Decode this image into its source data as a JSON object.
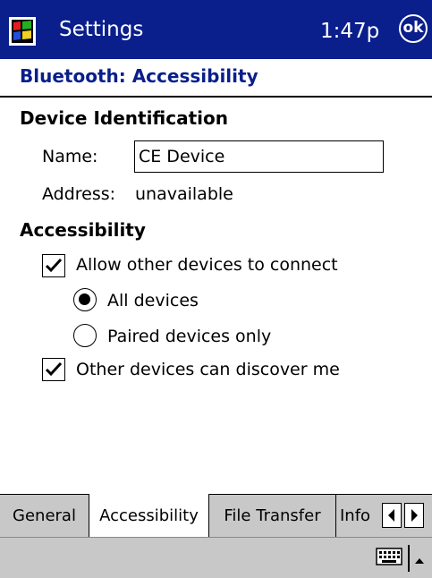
{
  "titlebar": {
    "app_title": "Settings",
    "clock": "1:47p",
    "ok_label": "ok",
    "start_icon": "windows-flag-icon",
    "color": "#0a1f8c"
  },
  "page": {
    "header": "Bluetooth: Accessibility"
  },
  "device_identification": {
    "title": "Device Identification",
    "name_label": "Name:",
    "name_value": "CE Device",
    "address_label": "Address:",
    "address_value": "unavailable"
  },
  "accessibility": {
    "title": "Accessibility",
    "allow_connect": {
      "label": "Allow other devices to connect",
      "checked": true
    },
    "radio_options": [
      {
        "label": "All devices",
        "selected": true
      },
      {
        "label": "Paired devices only",
        "selected": false
      }
    ],
    "discoverable": {
      "label": "Other devices can discover me",
      "checked": true
    }
  },
  "tabs": [
    {
      "label": "General",
      "active": false
    },
    {
      "label": "Accessibility",
      "active": true
    },
    {
      "label": "File Transfer",
      "active": false
    },
    {
      "label": "Info",
      "active": false
    }
  ],
  "command_bar": {
    "keyboard_icon": "keyboard-icon",
    "sip_arrow_icon": "caret-up-icon"
  }
}
